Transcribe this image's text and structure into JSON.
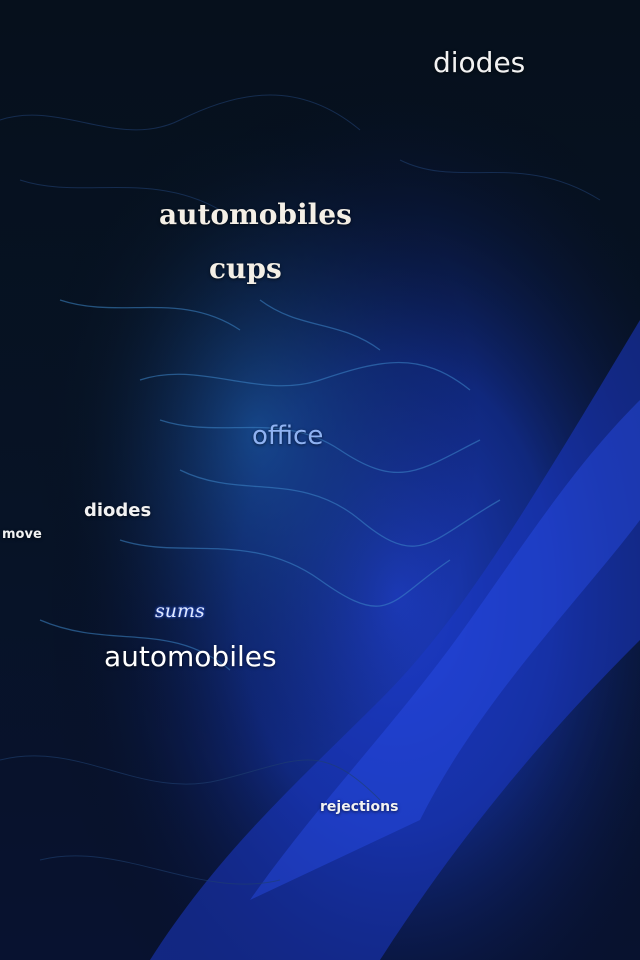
{
  "scene": {
    "description_colors": {
      "background_dark": "#05080f",
      "deep_blue": "#0f2a8a",
      "bright_blue": "#2a4fe0",
      "cyan_veins": "#3c8fd0"
    },
    "words": [
      {
        "id": "diodes-top",
        "text": "diodes"
      },
      {
        "id": "automobiles-top",
        "text": "automobiles"
      },
      {
        "id": "cups",
        "text": "cups"
      },
      {
        "id": "office",
        "text": "office"
      },
      {
        "id": "diodes-mid",
        "text": "diodes"
      },
      {
        "id": "move",
        "text": "move"
      },
      {
        "id": "sums",
        "text": "sums"
      },
      {
        "id": "automobiles-bottom",
        "text": "automobiles"
      },
      {
        "id": "rejections",
        "text": "rejections"
      }
    ]
  }
}
